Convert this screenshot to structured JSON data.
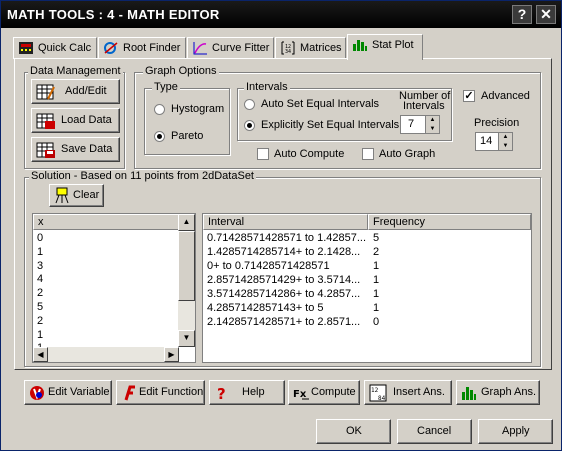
{
  "window": {
    "title": "MATH TOOLS : 4 - MATH EDITOR",
    "help_label": "?",
    "close_label": "✕"
  },
  "tabs": [
    {
      "label": "Quick Calc",
      "icon": "calculator-icon"
    },
    {
      "label": "Root Finder",
      "icon": "root-finder-icon"
    },
    {
      "label": "Curve Fitter",
      "icon": "curve-fitter-icon"
    },
    {
      "label": "Matrices",
      "icon": "matrix-icon"
    },
    {
      "label": "Stat Plot",
      "icon": "bar-chart-icon",
      "active": true
    }
  ],
  "data_management": {
    "label": "Data Management",
    "add_edit": "Add/Edit",
    "load_data": "Load Data",
    "save_data": "Save Data"
  },
  "graph_options": {
    "label": "Graph Options",
    "type_label": "Type",
    "histogram": "Hystogram",
    "pareto": "Pareto",
    "selected_type": "Pareto",
    "intervals_label": "Intervals",
    "auto_set": "Auto Set Equal Intervals",
    "explicit_set": "Explicitly Set Equal Intervals",
    "selected_interval_mode": "Explicitly Set Equal Intervals",
    "num_intervals_label_1": "Number of",
    "num_intervals_label_2": "Intervals",
    "num_intervals_value": "7",
    "advanced_label": "Advanced",
    "advanced_checked": true,
    "precision_label": "Precision",
    "precision_value": "14",
    "auto_compute_label": "Auto Compute",
    "auto_compute_checked": false,
    "auto_graph_label": "Auto Graph",
    "auto_graph_checked": false
  },
  "solution": {
    "label": "Solution - Based on 11 points from 2dDataSet",
    "clear_label": "Clear",
    "x_list": {
      "header": "x",
      "values": [
        "0",
        "1",
        "3",
        "4",
        "2",
        "5",
        "2",
        "1",
        "1"
      ]
    },
    "table": {
      "columns": [
        "Interval",
        "Frequency"
      ],
      "rows": [
        [
          "0.71428571428571 to 1.42857...",
          "5"
        ],
        [
          "1.4285714285714+ to 2.1428...",
          "2"
        ],
        [
          "0+ to 0.71428571428571",
          "1"
        ],
        [
          "2.8571428571429+ to 3.5714...",
          "1"
        ],
        [
          "3.5714285714286+ to 4.2857...",
          "1"
        ],
        [
          "4.2857142857143+ to 5",
          "1"
        ],
        [
          "2.1428571428571+ to 2.8571...",
          "0"
        ]
      ]
    }
  },
  "toolbar": {
    "edit_variable": "Edit Variable",
    "edit_function": "Edit Function",
    "help": "Help",
    "compute": "Compute",
    "insert_ans": "Insert Ans.",
    "graph_ans": "Graph Ans."
  },
  "footer": {
    "ok": "OK",
    "cancel": "Cancel",
    "apply": "Apply"
  }
}
